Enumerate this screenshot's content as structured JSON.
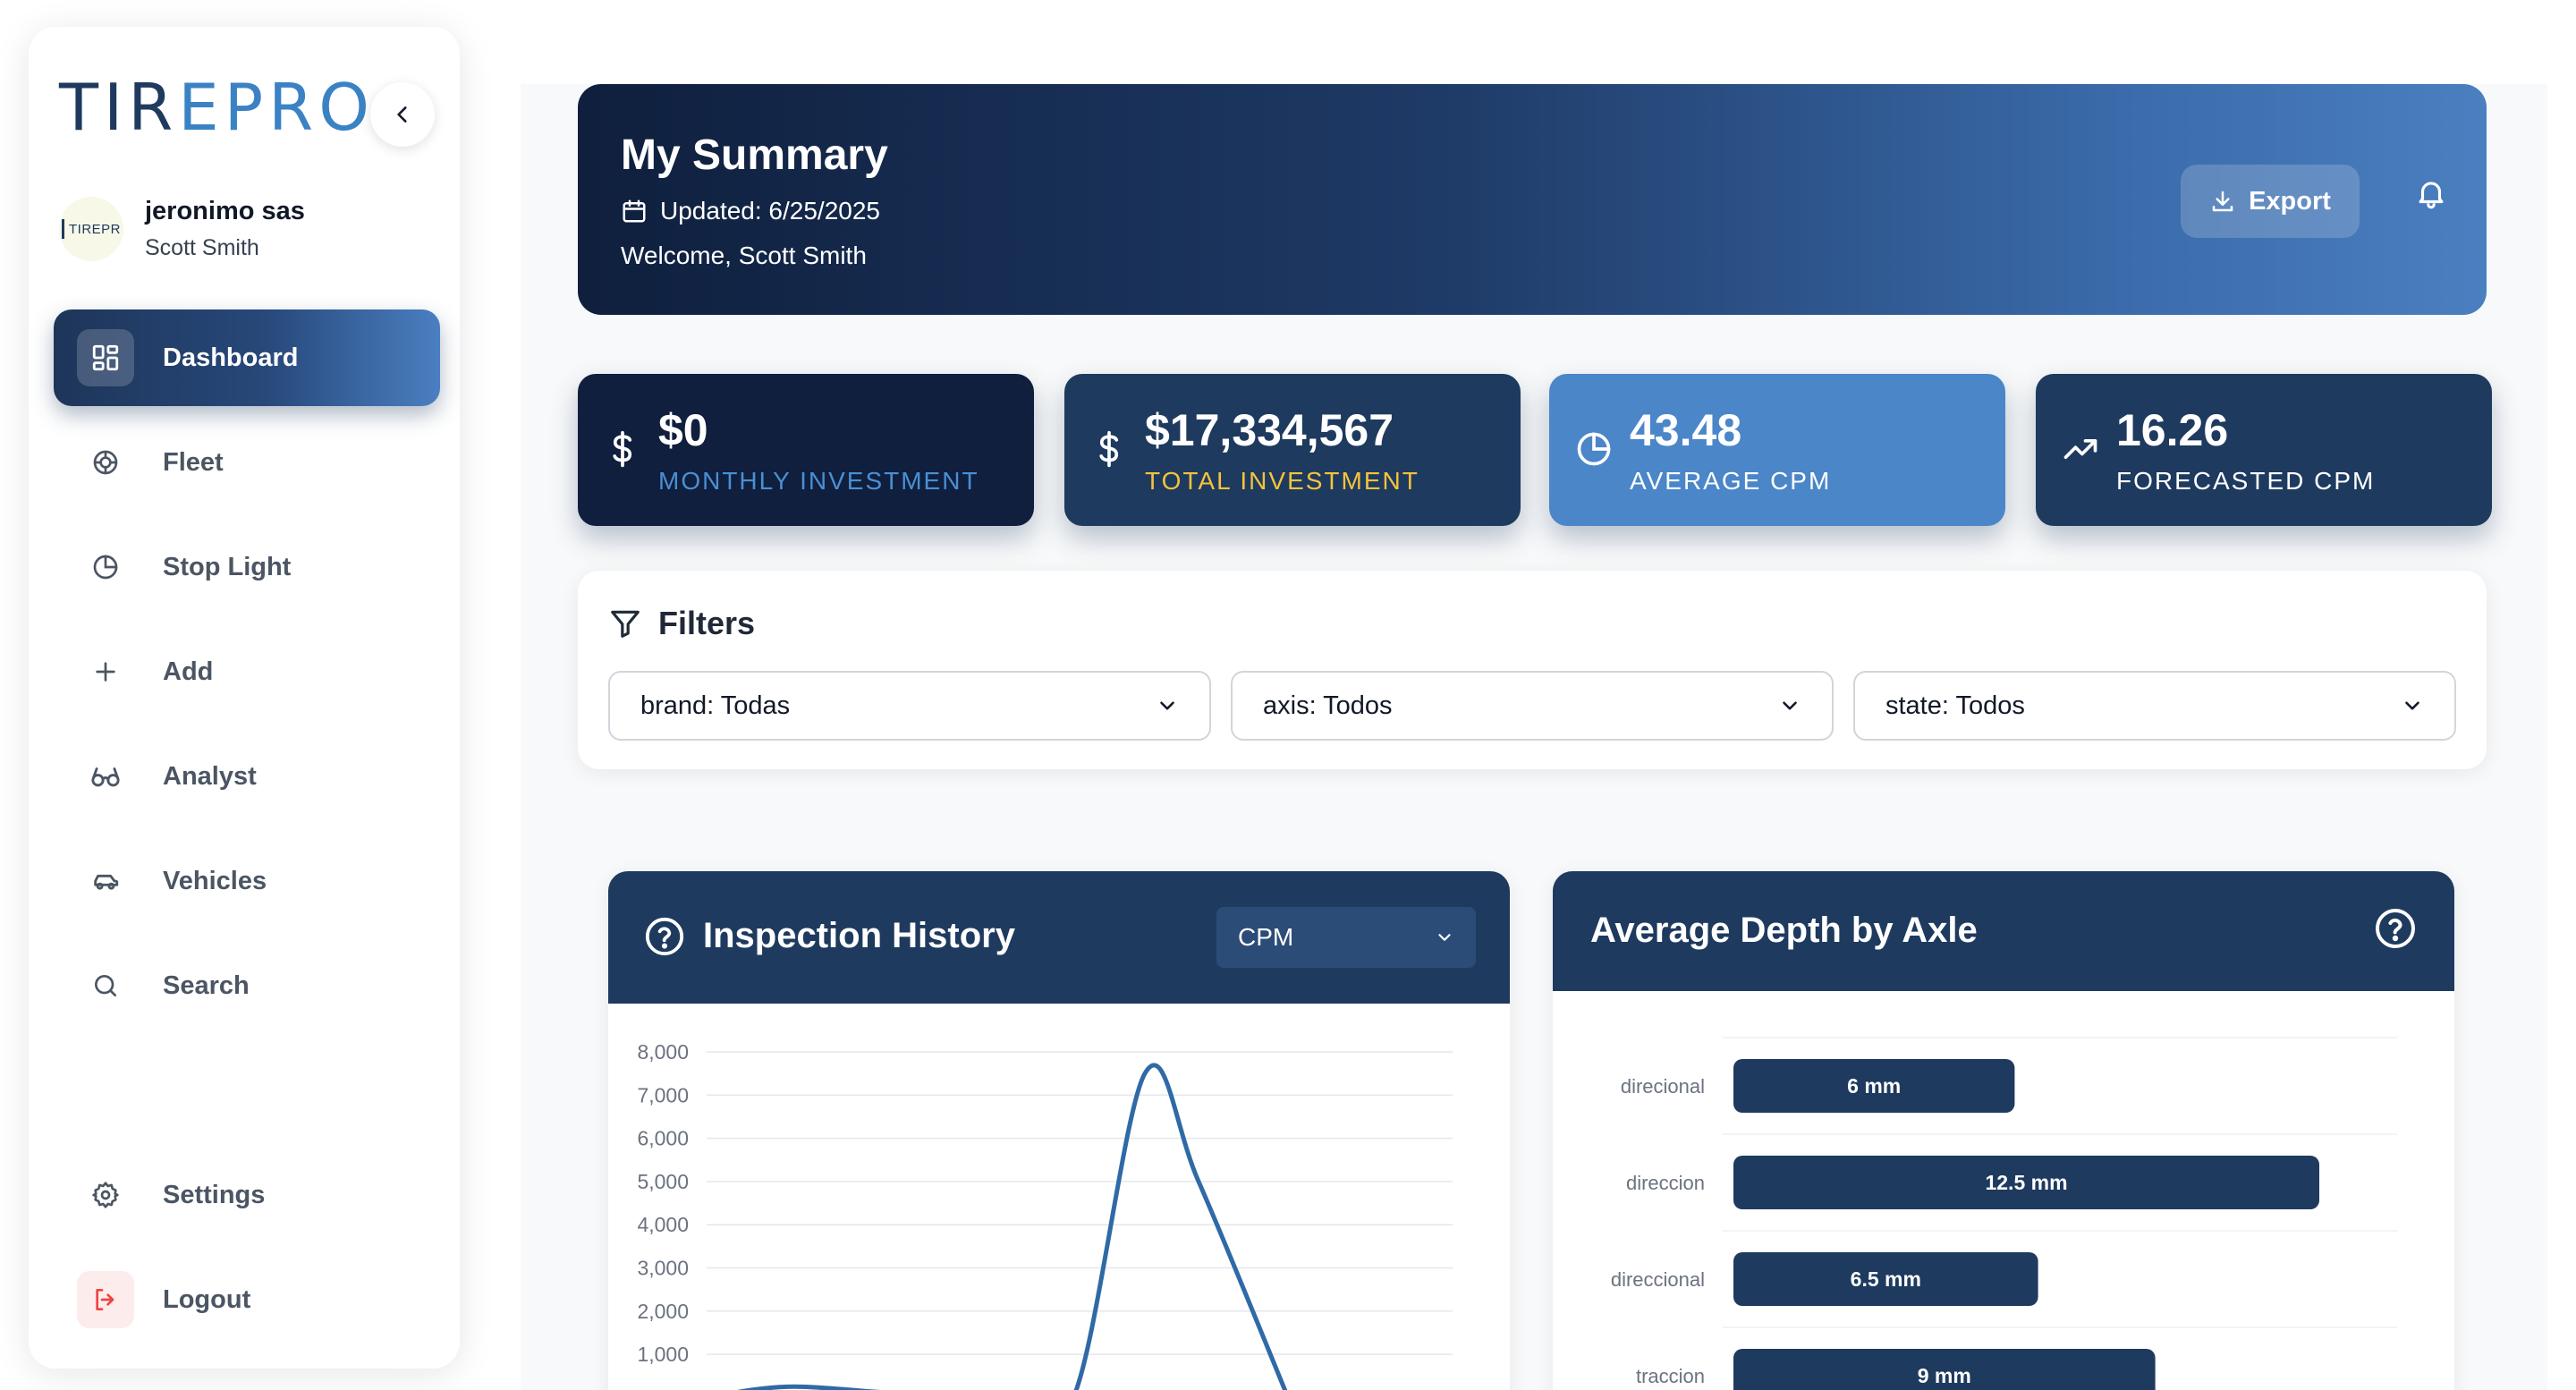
{
  "sidebar": {
    "logo_text": "TIREPRO",
    "logo_dark_part": "TIR",
    "logo_blue_part": "EPRO",
    "profile": {
      "avatar_text": "TIREPR",
      "company": "jeronimo sas",
      "user": "Scott Smith"
    },
    "items": [
      {
        "label": "Dashboard",
        "icon": "dashboard-grid-icon",
        "active": true
      },
      {
        "label": "Fleet",
        "icon": "tire-icon"
      },
      {
        "label": "Stop Light",
        "icon": "pie-clock-icon"
      },
      {
        "label": "Add",
        "icon": "plus-icon"
      },
      {
        "label": "Analyst",
        "icon": "glasses-icon"
      },
      {
        "label": "Vehicles",
        "icon": "car-icon"
      },
      {
        "label": "Search",
        "icon": "search-icon"
      },
      {
        "label": "Settings",
        "icon": "gear-icon"
      },
      {
        "label": "Logout",
        "icon": "logout-icon"
      }
    ]
  },
  "header": {
    "title": "My Summary",
    "updated": "Updated: 6/25/2025",
    "welcome": "Welcome, Scott Smith",
    "export_label": "Export"
  },
  "stats": [
    {
      "value": "$0",
      "label": "MONTHLY INVESTMENT",
      "icon": "dollar-icon",
      "bg": "#0f1f3d",
      "label_color": "#4a8fd4"
    },
    {
      "value": "$17,334,567",
      "label": "TOTAL INVESTMENT",
      "icon": "dollar-icon",
      "bg": "#1e3a5f",
      "label_color": "#f5c33b"
    },
    {
      "value": "43.48",
      "label": "AVERAGE CPM",
      "icon": "pie-chart-icon",
      "bg": "#4a86c8",
      "label_color": "#ffffff"
    },
    {
      "value": "16.26",
      "label": "FORECASTED CPM",
      "icon": "trending-up-icon",
      "bg": "#1e3a5f",
      "label_color": "#ffffff"
    }
  ],
  "filters": {
    "title": "Filters",
    "brand": "brand: Todas",
    "axis": "axis: Todos",
    "state": "state: Todos"
  },
  "inspection": {
    "title": "Inspection History",
    "metric": "CPM"
  },
  "depth": {
    "title": "Average Depth by Axle"
  },
  "colors": {
    "navy": "#1e3a5f",
    "accent_blue": "#3b82c4",
    "line": "#2f6aa6"
  },
  "chart_data": [
    {
      "type": "line",
      "title": "Inspection History",
      "yticks": [
        "8,000",
        "7,000",
        "6,000",
        "5,000",
        "4,000",
        "3,000",
        "2,000",
        "1,000"
      ],
      "ylim": [
        0,
        8000
      ],
      "series": [
        {
          "values": [
            0,
            250,
            100,
            0,
            0,
            7500,
            5000,
            0
          ]
        }
      ]
    },
    {
      "type": "bar",
      "orientation": "horizontal",
      "title": "Average Depth by Axle",
      "categories": [
        "direcional",
        "direccion",
        "direccional",
        "traccion"
      ],
      "values": [
        6,
        12.5,
        6.5,
        9
      ],
      "labels": [
        "6 mm",
        "12.5 mm",
        "6.5 mm",
        "9 mm"
      ],
      "xlim": [
        0,
        15
      ]
    }
  ]
}
